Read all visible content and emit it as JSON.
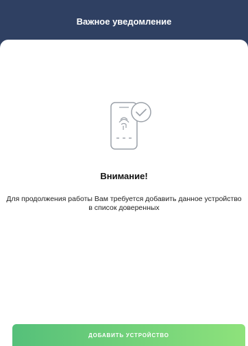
{
  "header": {
    "title": "Важное уведомление"
  },
  "notice": {
    "title": "Внимание!",
    "message": "Для продолжения работы Вам требуется добавить данное устройство в список доверенных",
    "icon": "trusted-device-icon"
  },
  "actions": {
    "add_device_label": "ДОБАВИТЬ УСТРОЙСТВО"
  },
  "colors": {
    "header_bg": "#2f4062",
    "button_gradient_start": "#55c07a",
    "button_gradient_end": "#8ee27b",
    "icon_stroke": "#9aa0a8"
  }
}
